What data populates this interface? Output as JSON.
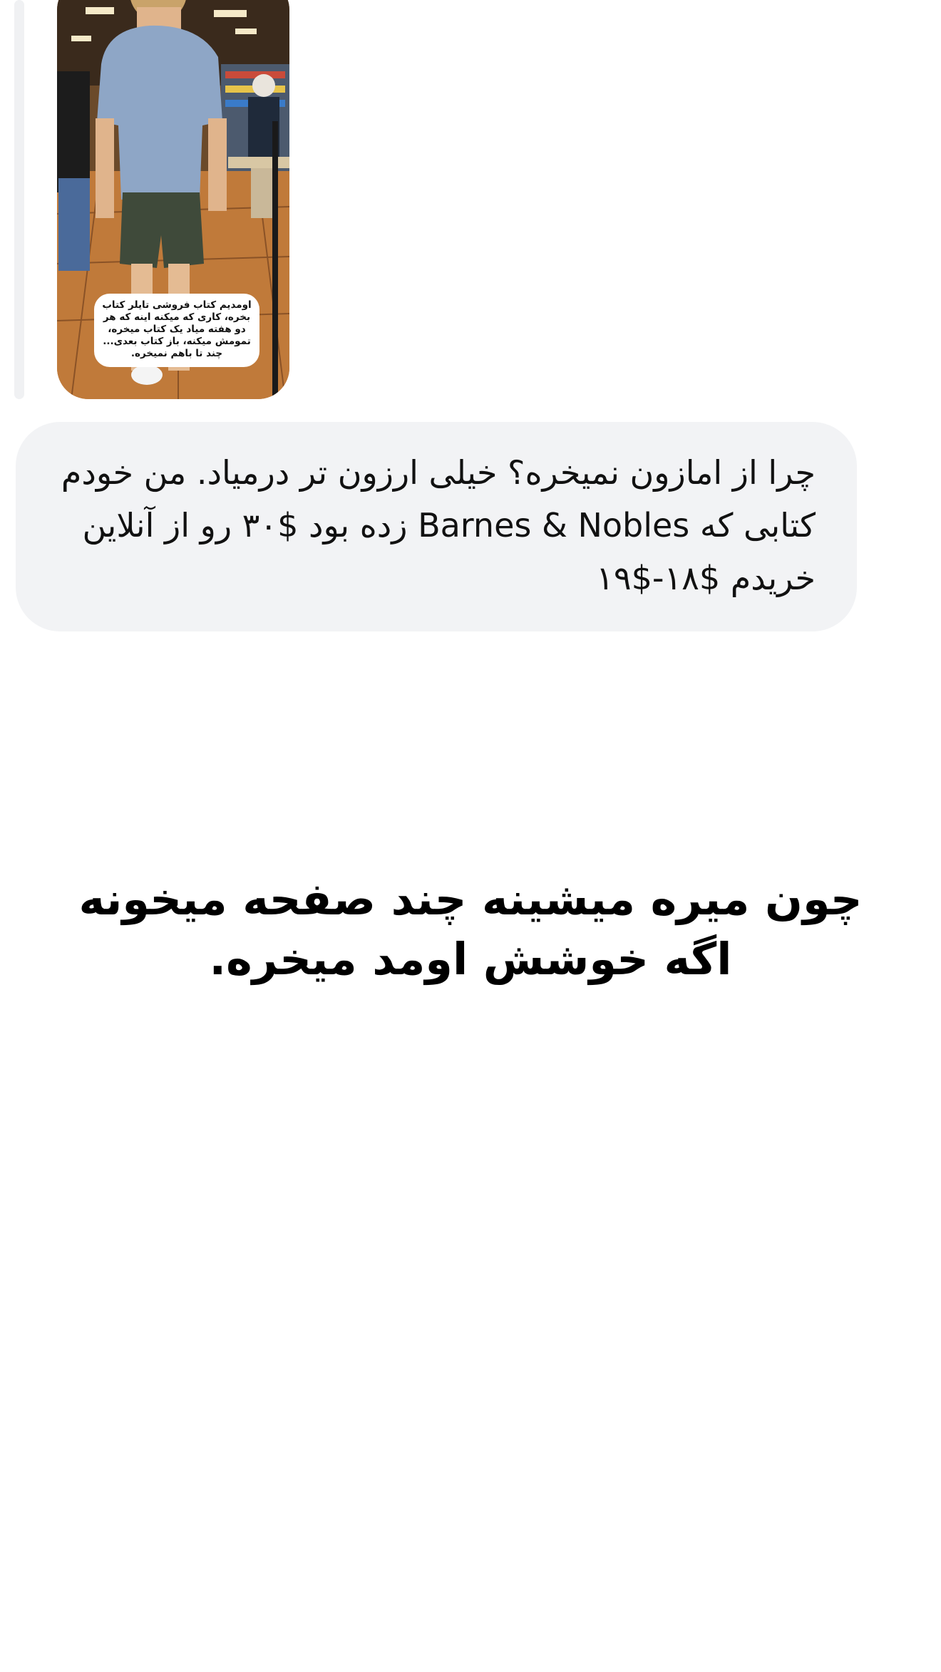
{
  "story": {
    "image_description_icon": "bookstore-photo",
    "caption": "اومدیم کتاب فروشی تایلر کتاب بخره، کاری که میکنه اینه که هر دو هفته میاد یک کتاب میخره، تمومش میکنه، باز کتاب بعدی... چند تا باهم نمیخره."
  },
  "reply": {
    "text": "چرا از امازون نمیخره؟ خیلی ارزون تر درمیاد. من خودم کتابی که Barnes & Nobles زده بود $۳۰ رو از آنلاین خریدم $۱۸-$۱۹"
  },
  "caption": {
    "text": "چون میره میشینه چند صفحه میخونه اگه خوشش اومد میخره."
  },
  "colors": {
    "bubble_bg": "#f2f3f5",
    "thread_line": "#f0f1f3",
    "text": "#111111"
  }
}
